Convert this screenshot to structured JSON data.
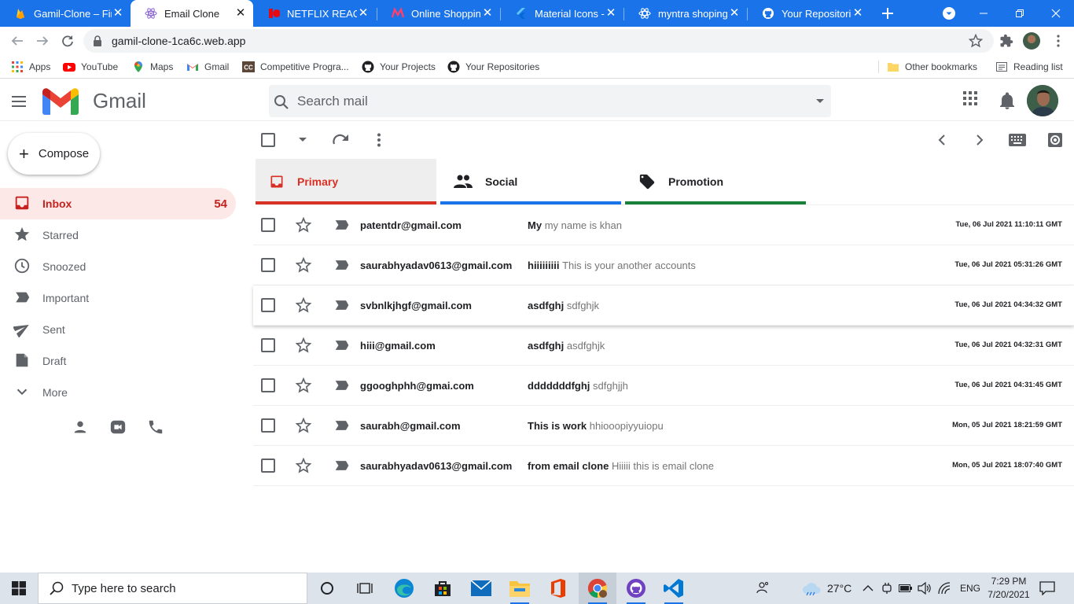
{
  "browser": {
    "tabs": [
      {
        "label": "Gamil-Clone – Fir",
        "icon": "firebase-icon"
      },
      {
        "label": "Email Clone",
        "icon": "react-icon"
      },
      {
        "label": "NETFLIX REAC",
        "icon": "netflix-icon"
      },
      {
        "label": "Online Shopping",
        "icon": "myntra-icon"
      },
      {
        "label": "Material Icons - M",
        "icon": "flutter-icon"
      },
      {
        "label": "myntra shoping s",
        "icon": "react-icon"
      },
      {
        "label": "Your Repositories",
        "icon": "github-icon"
      }
    ],
    "url": "gamil-clone-1ca6c.web.app",
    "bookmarks": [
      {
        "label": "Apps",
        "icon": "apps-grid-icon"
      },
      {
        "label": "YouTube",
        "icon": "youtube-icon"
      },
      {
        "label": "Maps",
        "icon": "maps-icon"
      },
      {
        "label": "Gmail",
        "icon": "gmail-icon"
      },
      {
        "label": "Competitive Progra...",
        "icon": "cc-icon"
      },
      {
        "label": "Your Projects",
        "icon": "github-icon"
      },
      {
        "label": "Your Repositories",
        "icon": "github-icon"
      }
    ],
    "other_bookmarks": "Other bookmarks",
    "reading_list": "Reading list"
  },
  "gmail": {
    "brand": "Gmail",
    "search_placeholder": "Search mail",
    "compose_label": "Compose",
    "sidebar": [
      {
        "label": "Inbox",
        "icon": "inbox-icon",
        "count": "54",
        "active": true
      },
      {
        "label": "Starred",
        "icon": "star-icon"
      },
      {
        "label": "Snoozed",
        "icon": "clock-icon"
      },
      {
        "label": "Important",
        "icon": "label-important-icon"
      },
      {
        "label": "Sent",
        "icon": "send-icon"
      },
      {
        "label": "Draft",
        "icon": "draft-icon"
      },
      {
        "label": "More",
        "icon": "expand-more-icon"
      }
    ],
    "categories": [
      {
        "label": "Primary",
        "icon": "inbox-icon",
        "color": "#d93025"
      },
      {
        "label": "Social",
        "icon": "people-icon",
        "color": "#1a73e8"
      },
      {
        "label": "Promotion",
        "icon": "local-offer-icon",
        "color": "#188038"
      }
    ],
    "emails": [
      {
        "sender": "patentdr@gmail.com",
        "subject": "My",
        "snippet": "my name is khan",
        "time": "Tue, 06 Jul 2021 11:10:11 GMT"
      },
      {
        "sender": "saurabhyadav0613@gmail.com",
        "subject": "hiiiiiiiii",
        "snippet": "This is your another accounts",
        "time": "Tue, 06 Jul 2021 05:31:26 GMT"
      },
      {
        "sender": "svbnlkjhgf@gmail.com",
        "subject": "asdfghj",
        "snippet": "sdfghjk",
        "time": "Tue, 06 Jul 2021 04:34:32 GMT"
      },
      {
        "sender": "hiii@gmail.com",
        "subject": "asdfghj",
        "snippet": "asdfghjk",
        "time": "Tue, 06 Jul 2021 04:32:31 GMT"
      },
      {
        "sender": "ggooghphh@gmai.com",
        "subject": "dddddddfghj",
        "snippet": "sdfghjjh",
        "time": "Tue, 06 Jul 2021 04:31:45 GMT"
      },
      {
        "sender": "saurabh@gmail.com",
        "subject": "This is work",
        "snippet": "hhiooopiyyuiopu",
        "time": "Mon, 05 Jul 2021 18:21:59 GMT"
      },
      {
        "sender": "saurabhyadav0613@gmail.com",
        "subject": "from email clone",
        "snippet": "Hiiiii this is email clone",
        "time": "Mon, 05 Jul 2021 18:07:40 GMT"
      }
    ]
  },
  "taskbar": {
    "search_placeholder": "Type here to search",
    "weather": "27°C",
    "language": "ENG",
    "time": "7:29 PM",
    "date": "7/20/2021"
  }
}
